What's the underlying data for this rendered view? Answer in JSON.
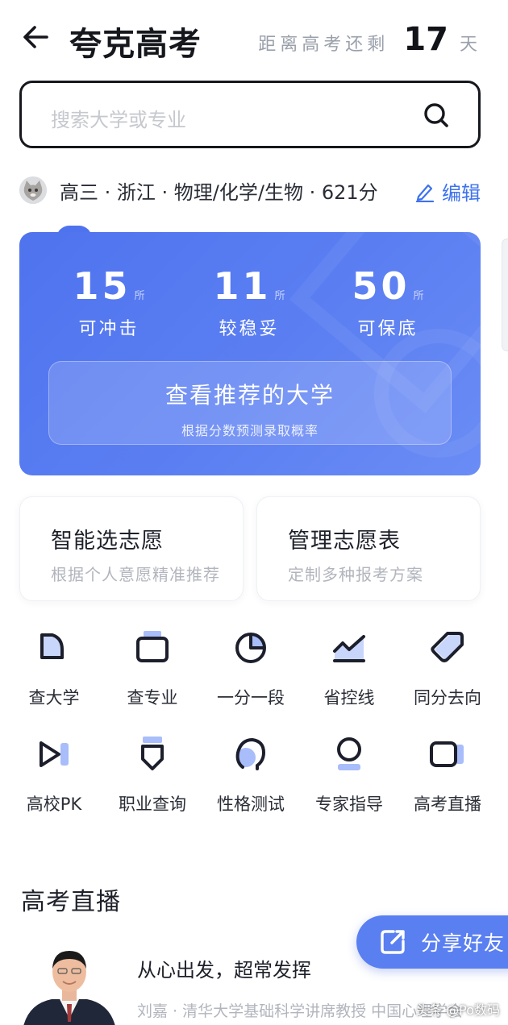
{
  "header": {
    "title": "夸克高考",
    "countdown_prefix": "距离高考还剩",
    "countdown_days": "17",
    "countdown_suffix": "天"
  },
  "search": {
    "placeholder": "搜索大学或专业"
  },
  "profile": {
    "summary": "高三 · 浙江 · 物理/化学/生物 · 621分",
    "edit_label": "编辑"
  },
  "recommend": {
    "stats": [
      {
        "value": "15",
        "unit": "所",
        "label": "可冲击"
      },
      {
        "value": "11",
        "unit": "所",
        "label": "较稳妥"
      },
      {
        "value": "50",
        "unit": "所",
        "label": "可保底"
      }
    ],
    "button_title": "查看推荐的大学",
    "button_sub": "根据分数预测录取概率"
  },
  "features": [
    {
      "title": "智能选志愿",
      "sub": "根据个人意愿精准推荐"
    },
    {
      "title": "管理志愿表",
      "sub": "定制多种报考方案"
    }
  ],
  "tools": [
    {
      "label": "查大学",
      "icon": "university-icon"
    },
    {
      "label": "查专业",
      "icon": "major-icon"
    },
    {
      "label": "一分一段",
      "icon": "pie-chart-icon"
    },
    {
      "label": "省控线",
      "icon": "trend-line-icon"
    },
    {
      "label": "同分去向",
      "icon": "tag-icon"
    },
    {
      "label": "高校PK",
      "icon": "versus-icon"
    },
    {
      "label": "职业查询",
      "icon": "badge-icon"
    },
    {
      "label": "性格测试",
      "icon": "personality-icon"
    },
    {
      "label": "专家指导",
      "icon": "expert-icon"
    },
    {
      "label": "高考直播",
      "icon": "live-video-icon"
    }
  ],
  "live_section": {
    "title": "高考直播",
    "item_title": "从心出发，超常发挥",
    "item_sub": "刘嘉 · 清华大学基础科学讲席教授 中国心理学会"
  },
  "share": {
    "label": "分享好友"
  },
  "watermark": "头条 @Po数码",
  "colors": {
    "accent": "#5a7ff1",
    "card": "#4f73ee",
    "text": "#1d2029",
    "muted": "#b2b5bd"
  }
}
